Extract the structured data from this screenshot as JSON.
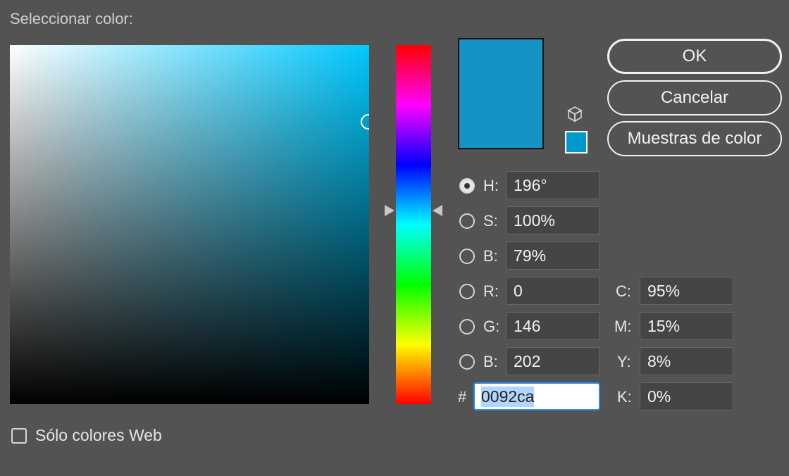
{
  "dialog": {
    "title": "Seleccionar color:"
  },
  "colors": {
    "current": "#1593c5",
    "web_swatch": "#0099cc",
    "field_hue": "#00c8ff"
  },
  "buttons": {
    "ok": "OK",
    "cancel": "Cancelar",
    "swatches": "Muestras de color"
  },
  "icons": {
    "gamut": "cube-icon"
  },
  "hsb": [
    {
      "label": "H:",
      "value": "196°",
      "selected": true
    },
    {
      "label": "S:",
      "value": "100%",
      "selected": false
    },
    {
      "label": "B:",
      "value": "79%",
      "selected": false
    }
  ],
  "rgb": [
    {
      "label": "R:",
      "value": "0",
      "selected": false
    },
    {
      "label": "G:",
      "value": "146",
      "selected": false
    },
    {
      "label": "B:",
      "value": "202",
      "selected": false
    }
  ],
  "cmyk": [
    {
      "label": "C:",
      "value": "95%"
    },
    {
      "label": "M:",
      "value": "15%"
    },
    {
      "label": "Y:",
      "value": "8%"
    },
    {
      "label": "K:",
      "value": "0%"
    }
  ],
  "hex": {
    "label": "#",
    "value": "0092ca"
  },
  "web_only": {
    "label": "Sólo colores Web",
    "checked": false
  }
}
